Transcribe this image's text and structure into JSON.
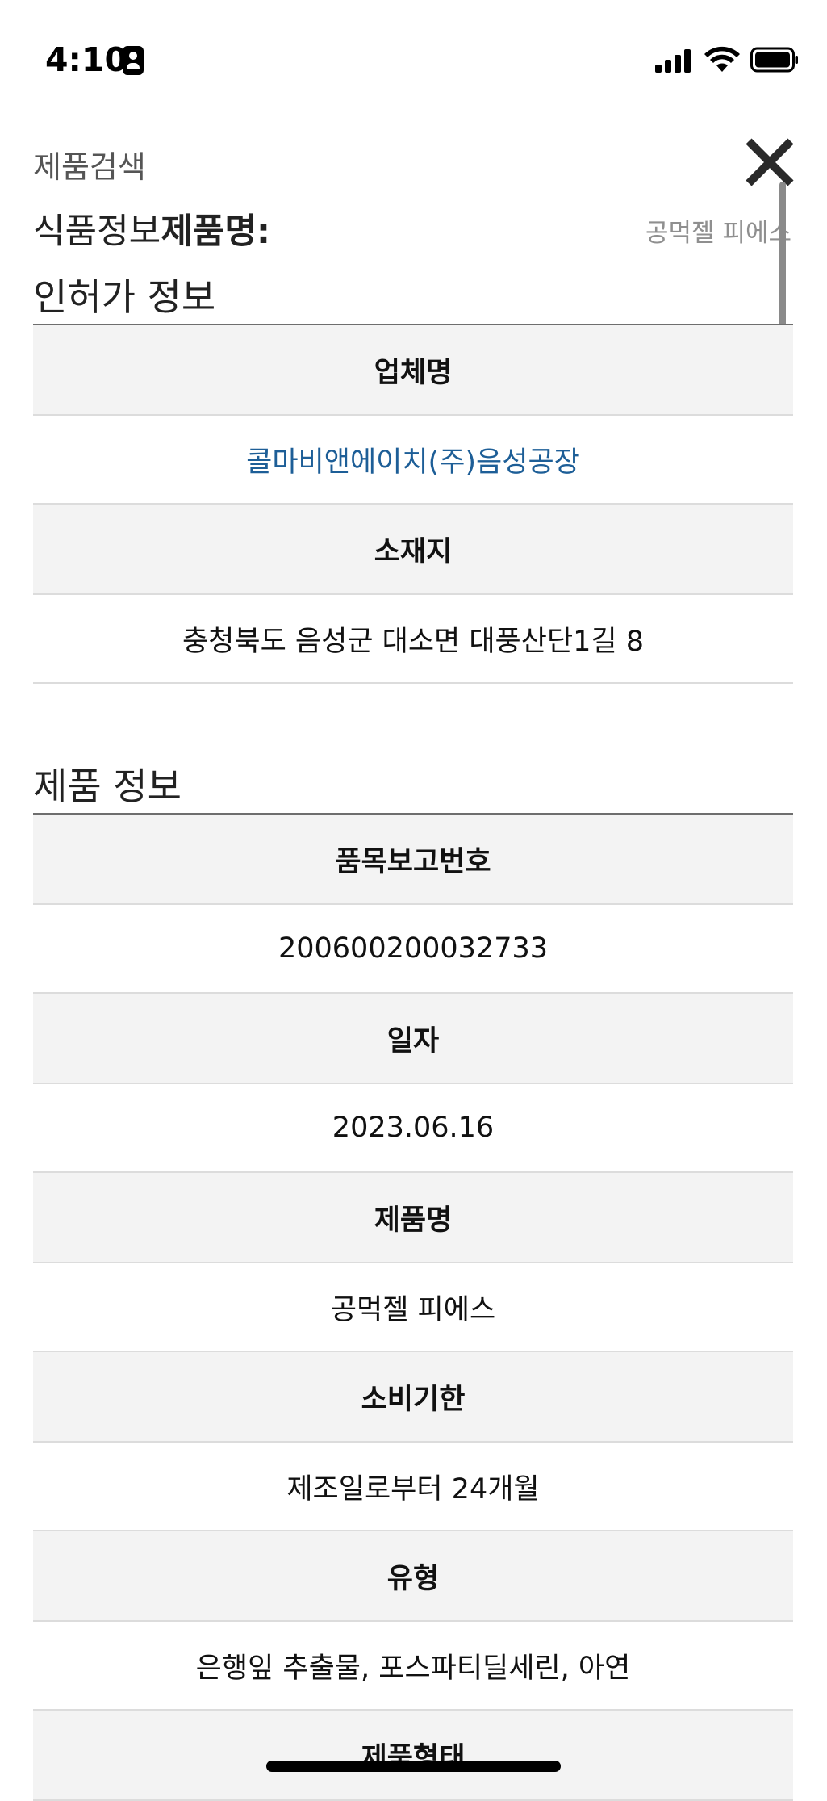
{
  "status_bar": {
    "time": "4:10"
  },
  "header": {
    "breadcrumb": "제품검색",
    "info_prefix": "식품정보",
    "info_label": "제품명:",
    "product_name": "공먹젤 피에스"
  },
  "license_section": {
    "title": "인허가 정보",
    "rows": [
      {
        "label": "업체명",
        "value": "콜마비앤에이치(주)음성공장"
      },
      {
        "label": "소재지",
        "value": "충청북도 음성군 대소면 대풍산단1길 8"
      }
    ]
  },
  "product_section": {
    "title": "제품 정보",
    "rows": [
      {
        "label": "품목보고번호",
        "value": "200600200032733"
      },
      {
        "label": "일자",
        "value": "2023.06.16"
      },
      {
        "label": "제품명",
        "value": "공먹젤 피에스"
      },
      {
        "label": "소비기한",
        "value": "제조일로부터 24개월"
      },
      {
        "label": "유형",
        "value": "은행잎 추출물, 포스파티딜세린, 아연"
      },
      {
        "label": "제품형태",
        "value": ""
      }
    ]
  },
  "colors": {
    "link": "#1d5e97",
    "header_row_bg": "#f3f3f3",
    "divider": "#dcdcdc"
  }
}
